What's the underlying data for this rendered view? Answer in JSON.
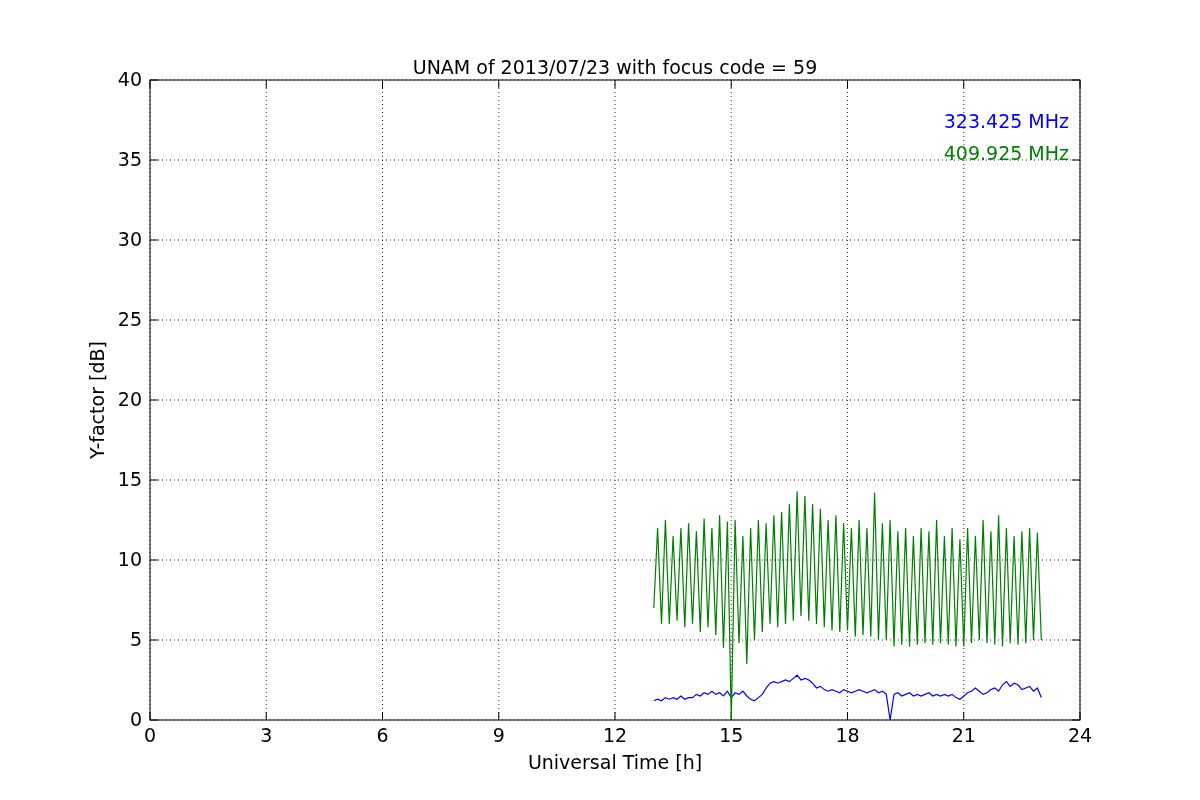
{
  "figure": {
    "chart_data": {
      "type": "line",
      "title": "UNAM of 2013/07/23 with focus code = 59",
      "xlabel": "Universal Time [h]",
      "ylabel": "Y-factor [dB]",
      "x": [
        13,
        13.1,
        13.2,
        13.3,
        13.4,
        13.5,
        13.6,
        13.7,
        13.8,
        13.9,
        14,
        14.1,
        14.2,
        14.3,
        14.4,
        14.5,
        14.6,
        14.7,
        14.8,
        14.9,
        15,
        15.1,
        15.2,
        15.3,
        15.4,
        15.5,
        15.6,
        15.7,
        15.8,
        15.9,
        16,
        16.1,
        16.2,
        16.3,
        16.4,
        16.5,
        16.6,
        16.7,
        16.8,
        16.9,
        17,
        17.1,
        17.2,
        17.3,
        17.4,
        17.5,
        17.6,
        17.7,
        17.8,
        17.9,
        18,
        18.1,
        18.2,
        18.3,
        18.4,
        18.5,
        18.6,
        18.7,
        18.8,
        18.9,
        19,
        19.1,
        19.2,
        19.3,
        19.4,
        19.5,
        19.6,
        19.7,
        19.8,
        19.9,
        20,
        20.1,
        20.2,
        20.3,
        20.4,
        20.5,
        20.6,
        20.7,
        20.8,
        20.9,
        21,
        21.1,
        21.2,
        21.3,
        21.4,
        21.5,
        21.6,
        21.7,
        21.8,
        21.9,
        22,
        22.1,
        22.2,
        22.3,
        22.4,
        22.5,
        22.6,
        22.7,
        22.8,
        22.9,
        23
      ],
      "series": [
        {
          "name": "323.425 MHz",
          "color": "#0000ff",
          "values": [
            1.2,
            1.3,
            1.2,
            1.4,
            1.3,
            1.4,
            1.3,
            1.5,
            1.3,
            1.4,
            1.4,
            1.6,
            1.5,
            1.7,
            1.6,
            1.8,
            1.6,
            1.7,
            1.5,
            1.8,
            1.4,
            1.7,
            1.6,
            1.8,
            1.5,
            1.3,
            1.2,
            1.4,
            1.6,
            2.0,
            2.3,
            2.4,
            2.3,
            2.4,
            2.5,
            2.4,
            2.6,
            2.8,
            2.5,
            2.6,
            2.5,
            2.3,
            2.0,
            2.1,
            1.9,
            1.8,
            1.9,
            1.8,
            1.7,
            1.9,
            1.8,
            1.7,
            1.8,
            1.9,
            1.8,
            1.7,
            1.8,
            1.9,
            1.7,
            1.8,
            1.6,
            0,
            1.6,
            1.7,
            1.5,
            1.6,
            1.7,
            1.5,
            1.6,
            1.5,
            1.6,
            1.7,
            1.5,
            1.6,
            1.5,
            1.6,
            1.5,
            1.6,
            1.4,
            1.3,
            1.5,
            1.7,
            1.8,
            2.0,
            1.8,
            1.6,
            1.7,
            1.9,
            2.0,
            1.8,
            2.2,
            2.4,
            2.1,
            2.3,
            2.2,
            1.9,
            2.0,
            2.1,
            1.8,
            2.0,
            1.4
          ]
        },
        {
          "name": "409.925 MHz",
          "color": "#008000",
          "values": [
            7,
            12,
            6,
            12.5,
            6,
            11.5,
            6.2,
            12,
            5.8,
            12.3,
            6,
            11.8,
            5.5,
            12.6,
            5.8,
            12,
            5.3,
            12.8,
            4.5,
            12.4,
            0,
            12.5,
            4.8,
            11.5,
            3.5,
            12,
            5,
            12.5,
            5.5,
            12.3,
            6,
            12.8,
            5.8,
            13,
            6,
            13.5,
            6.2,
            14.3,
            6.5,
            14,
            6.2,
            13.5,
            6,
            13.2,
            5.8,
            12.5,
            5.6,
            12.8,
            5.5,
            12.3,
            5.6,
            12,
            5.2,
            12.5,
            5.3,
            12,
            5.2,
            14.2,
            5,
            12.3,
            5,
            12.5,
            4.6,
            11.8,
            4.7,
            12,
            4.6,
            11.5,
            4.7,
            12,
            4.8,
            11.8,
            4.7,
            12.5,
            4.8,
            11.5,
            4.7,
            12,
            4.6,
            11.3,
            4.6,
            12,
            4.8,
            11.5,
            5,
            12.5,
            4.8,
            11.8,
            4.7,
            12.8,
            4.6,
            12,
            4.8,
            11.5,
            4.7,
            11.8,
            4.8,
            12,
            5,
            11.7,
            5
          ]
        }
      ],
      "grid": true,
      "xlim": [
        0,
        24
      ],
      "ylim": [
        0,
        40
      ],
      "xticks": [
        0,
        3,
        6,
        9,
        12,
        15,
        18,
        21,
        24
      ],
      "yticks": [
        0,
        5,
        10,
        15,
        20,
        25,
        30,
        35,
        40
      ]
    }
  }
}
